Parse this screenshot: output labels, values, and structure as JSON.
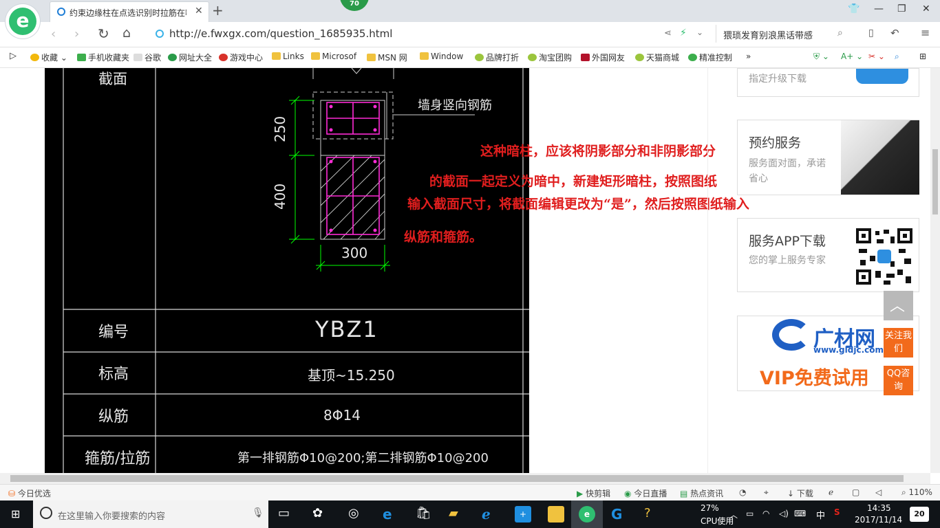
{
  "browser": {
    "tab_title": "约束边缘柱在点选识别时拉筋在哪",
    "badge": "70",
    "url": "http://e.fwxgx.com/question_1685935.html",
    "search_text": "猥琐发育别浪黑话带感",
    "bookmarks": [
      "收藏",
      "手机收藏夹",
      "谷歌",
      "网址大全",
      "游戏中心",
      "Links",
      "Microsof",
      "MSN 网",
      "Window",
      "品牌打折",
      "淘宝团购",
      "外国网友",
      "天猫商城",
      "精准控制"
    ]
  },
  "drawing": {
    "label_section": "截面",
    "label_wall_rebar": "墙身竖向钢筋",
    "dim_250": "250",
    "dim_400": "400",
    "dim_300": "300",
    "rows": [
      {
        "label": "编号",
        "value": "YBZ1"
      },
      {
        "label": "标高",
        "value": "基顶~15.250"
      },
      {
        "label": "纵筋",
        "value": "8Φ14"
      },
      {
        "label": "箍筋/拉筋",
        "value": "第一排钢筋Φ10@200;第二排钢筋Φ10@200"
      }
    ]
  },
  "annotation": [
    "这种暗柱，应该将阴影部分和非阴影部分",
    "的截面一起定义为暗中，新建矩形暗柱，按照图纸",
    "输入截面尺寸，将截面编辑更改为“是”，然后按照图纸输入",
    "纵筋和箍筋。"
  ],
  "sidebar": {
    "card1_sub": "指定升级下载",
    "card2_title": "预约服务",
    "card2_sub": "服务面对面，承诺省心",
    "card3_title": "服务APP下载",
    "card3_sub": "您的掌上服务专家",
    "ad_brand": "广材网",
    "ad_url": "www.gldjc.com",
    "ad_vip": "VIP免费试用",
    "follow_label": "关注我们",
    "qq_label": "QQ咨询"
  },
  "statusbar": {
    "left": "今日优选",
    "items": [
      "快剪辑",
      "今日直播",
      "热点资讯",
      "下载"
    ],
    "zoom": "110%"
  },
  "taskbar": {
    "search_placeholder": "在这里输入你要搜索的内容",
    "cpu_percent": "27%",
    "cpu_label": "CPU使用",
    "ime": "中",
    "time": "14:35",
    "date": "2017/11/14",
    "notifications": "20"
  },
  "colors": {
    "annotation_red": "#e01e1e",
    "cad_green": "#00ff00",
    "cad_magenta": "#ff00ff",
    "orange": "#f26a1b"
  }
}
